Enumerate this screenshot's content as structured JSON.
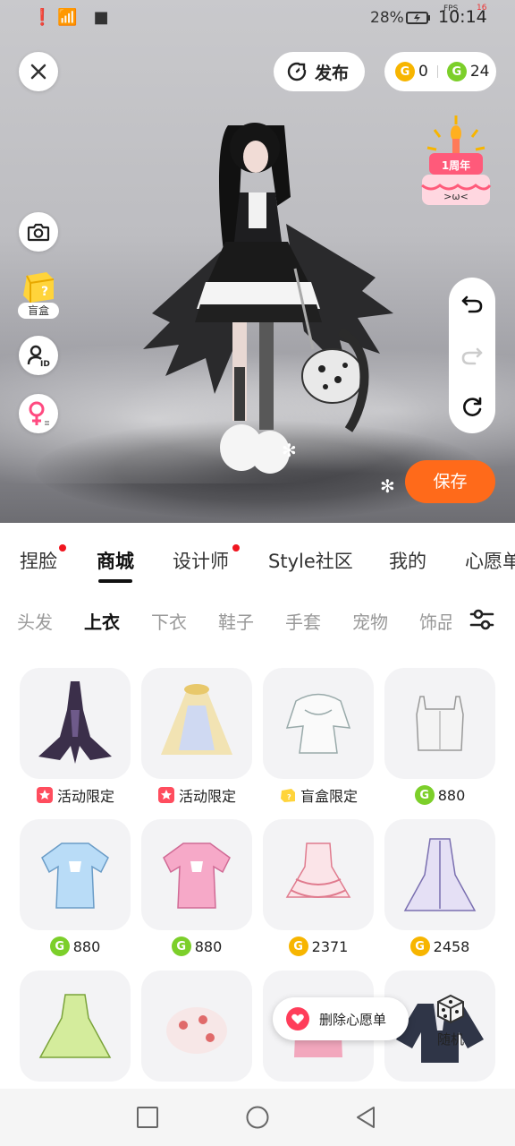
{
  "status_bar": {
    "left_icons": "❗📶 ■",
    "battery_percent": "28%",
    "time": "10:14",
    "fps_label": "FPS",
    "fps_value": "16"
  },
  "top_bar": {
    "publish_label": "发布",
    "gold_coins": "0",
    "green_coins": "24"
  },
  "side_tools": {
    "blind_box_label": "盲盒",
    "anniversary_badge": "1周年"
  },
  "scene": {
    "save_label": "保存"
  },
  "main_tabs": [
    {
      "label": "捏脸",
      "dot": true
    },
    {
      "label": "商城",
      "dot": false,
      "active": true
    },
    {
      "label": "设计师",
      "dot": true
    },
    {
      "label": "Style社区",
      "dot": false
    },
    {
      "label": "我的",
      "dot": false
    },
    {
      "label": "心愿单",
      "dot": false
    }
  ],
  "sub_tabs": [
    {
      "label": "头发"
    },
    {
      "label": "上衣",
      "active": true
    },
    {
      "label": "下衣"
    },
    {
      "label": "鞋子"
    },
    {
      "label": "手套"
    },
    {
      "label": "宠物"
    },
    {
      "label": "饰品"
    }
  ],
  "items": [
    {
      "tag_type": "event",
      "tag": "活动限定",
      "item": "dark-gown"
    },
    {
      "tag_type": "event",
      "tag": "活动限定",
      "item": "cream-cape-dress"
    },
    {
      "tag_type": "blindbox",
      "tag": "盲盒限定",
      "item": "white-frill-top"
    },
    {
      "tag_type": "green",
      "tag": "880",
      "item": "white-corset"
    },
    {
      "tag_type": "green",
      "tag": "880",
      "item": "blue-tee"
    },
    {
      "tag_type": "green",
      "tag": "880",
      "item": "pink-tee"
    },
    {
      "tag_type": "gold",
      "tag": "2371",
      "item": "pink-ruffle-dress"
    },
    {
      "tag_type": "gold",
      "tag": "2458",
      "item": "lavender-robe"
    },
    {
      "tag_type": "none",
      "tag": "",
      "item": "green-fairy-dress"
    },
    {
      "tag_type": "none",
      "tag": "",
      "item": "red-white-fur"
    },
    {
      "tag_type": "none",
      "tag": "",
      "item": "pink-top"
    },
    {
      "tag_type": "none",
      "tag": "",
      "item": "navy-jacket"
    }
  ],
  "wishlist": {
    "remove_label": "删除心愿单"
  },
  "random": {
    "label": "随机"
  },
  "colors": {
    "accent_orange": "#ff6a1a",
    "green_coin": "#7ccf2a",
    "gold_coin": "#f7b500",
    "red_dot": "#f0151f",
    "event_tag": "#ff4d5e"
  }
}
